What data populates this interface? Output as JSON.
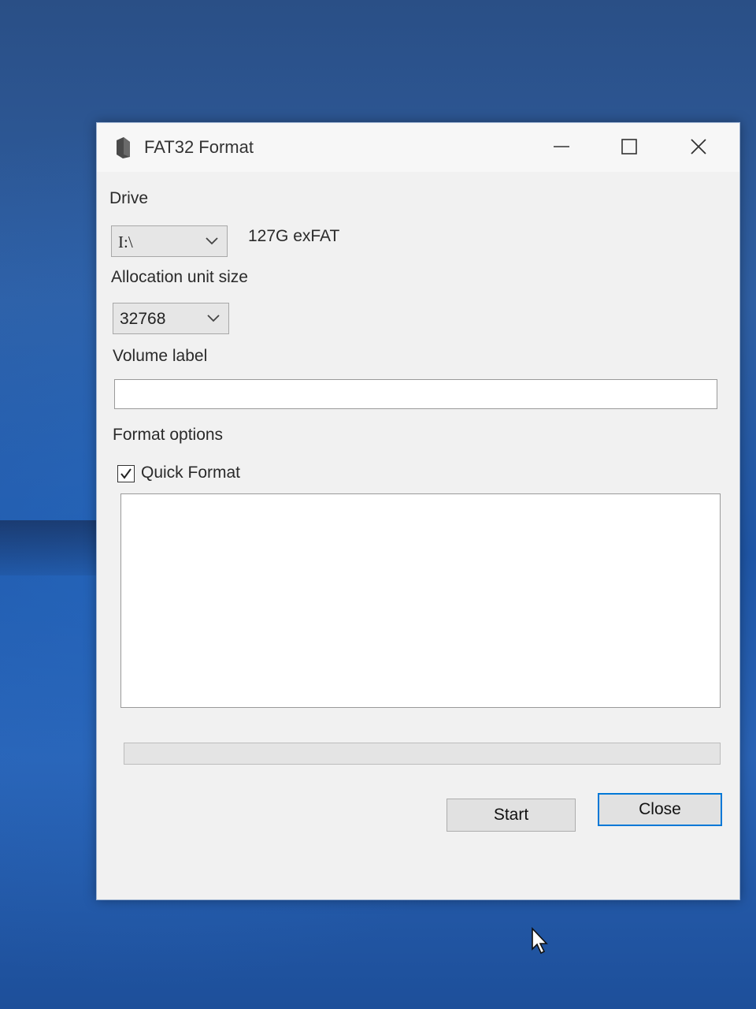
{
  "window": {
    "title": "FAT32 Format",
    "controls": {
      "minimize": "minimize",
      "maximize": "maximize",
      "close": "close"
    }
  },
  "drive": {
    "label": "Drive",
    "selected": "I:\\",
    "info": "127G exFAT"
  },
  "allocation": {
    "label": "Allocation unit size",
    "selected": "32768"
  },
  "volume_label": {
    "label": "Volume label",
    "value": ""
  },
  "format_options": {
    "label": "Format options",
    "quick_format_label": "Quick Format",
    "quick_format_checked": true
  },
  "log": {
    "text": ""
  },
  "progress": {
    "value": 0
  },
  "buttons": {
    "start": "Start",
    "close": "Close"
  },
  "colors": {
    "accent": "#0078d7",
    "window_bg": "#f1f1f1",
    "desktop": "#2f5fa3"
  },
  "icons": [
    "app-drive-icon",
    "minimize-icon",
    "maximize-icon",
    "close-icon",
    "chevron-down-icon",
    "checkmark-icon",
    "mouse-cursor-icon"
  ]
}
